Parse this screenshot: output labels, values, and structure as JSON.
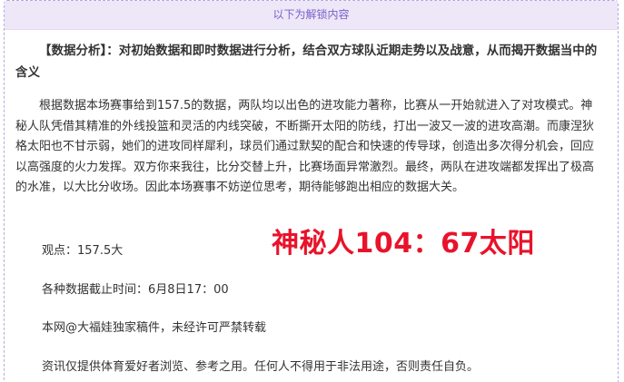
{
  "header": {
    "unlock_label": "以下为解锁内容"
  },
  "article": {
    "analysis_heading": "【数据分析】：对初始数据和即时数据进行分析，结合双方球队近期走势以及战意，从而揭开数据当中的含义",
    "analysis_body": "根据数据本场赛事给到157.5的数据，两队均以出色的进攻能力著称，比赛从一开始就进入了对攻模式。神秘人队凭借其精准的外线投篮和灵活的内线突破，不断撕开太阳的防线，打出一波又一波的进攻高潮。而康涅狄格太阳也不甘示弱，她们的进攻同样犀利，球员们通过默契的配合和快速的传导球，创造出多次得分机会，回应以高强度的火力发挥。双方你来我往，比分交替上升，比赛场面异常激烈。最终，两队在进攻端都发挥出了极高的水准，以大比分收场。因此本场赛事不妨逆位思考，期待能够跑出相应的数据大关。",
    "viewpoint": "观点：157.5大",
    "cutoff_time": "各种数据截止时间：6月8日17：00",
    "copyright": "本网@大福娃独家稿件，未经许可严禁转载",
    "disclaimer": "资讯仅提供体育爱好者浏览、参考之用。任何人不得用于非法用途，否则责任自负。"
  },
  "result": {
    "score_text": "神秘人104：67太阳",
    "color": "#e8132b"
  }
}
